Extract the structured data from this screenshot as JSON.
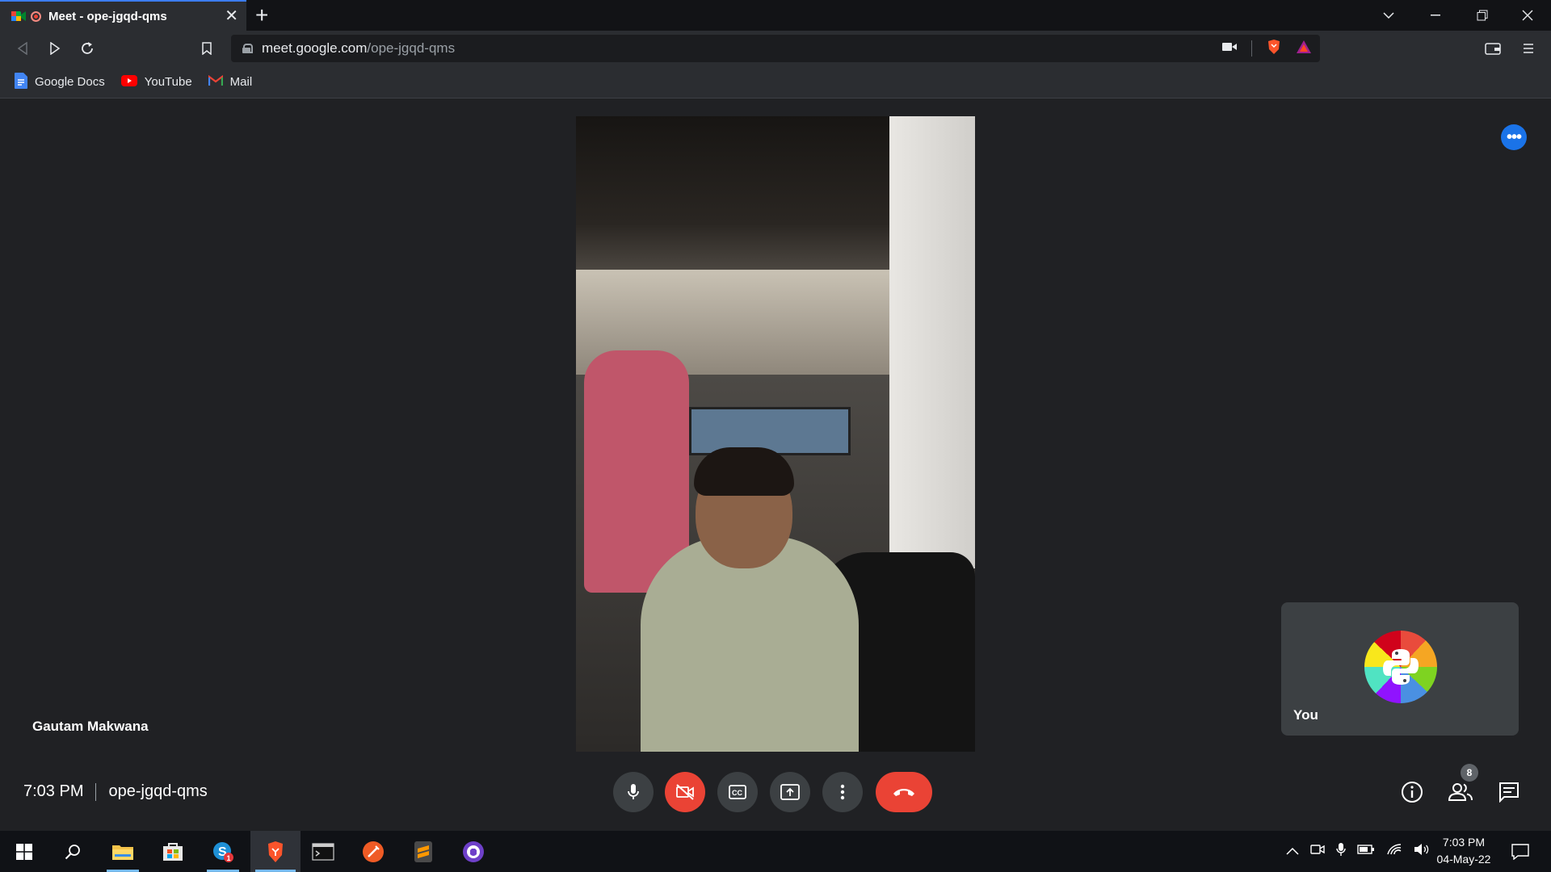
{
  "browser": {
    "tab_title": "Meet - ope-jgqd-qms",
    "url_host": "meet.google.com",
    "url_path": "/ope-jgqd-qms",
    "bookmarks": [
      {
        "label": "Google Docs",
        "icon": "google-docs-icon"
      },
      {
        "label": "YouTube",
        "icon": "youtube-icon"
      },
      {
        "label": "Mail",
        "icon": "gmail-icon"
      }
    ]
  },
  "meet": {
    "speaker_name": "Gautam Makwana",
    "self_label": "You",
    "time": "7:03 PM",
    "meeting_code": "ope-jgqd-qms",
    "participants_count": "8",
    "mic_on": true,
    "camera_on": false,
    "colors": {
      "accent": "#1a73e8",
      "danger": "#ea4335",
      "surface": "#3c4043",
      "background": "#202124"
    }
  },
  "taskbar": {
    "apps": [
      "windows-start",
      "search",
      "file-explorer",
      "microsoft-store",
      "skype",
      "brave",
      "terminal",
      "postman",
      "sublime-text",
      "github-desktop"
    ],
    "skype_badge": "1",
    "clock_time": "7:03 PM",
    "clock_date": "04-May-22"
  }
}
